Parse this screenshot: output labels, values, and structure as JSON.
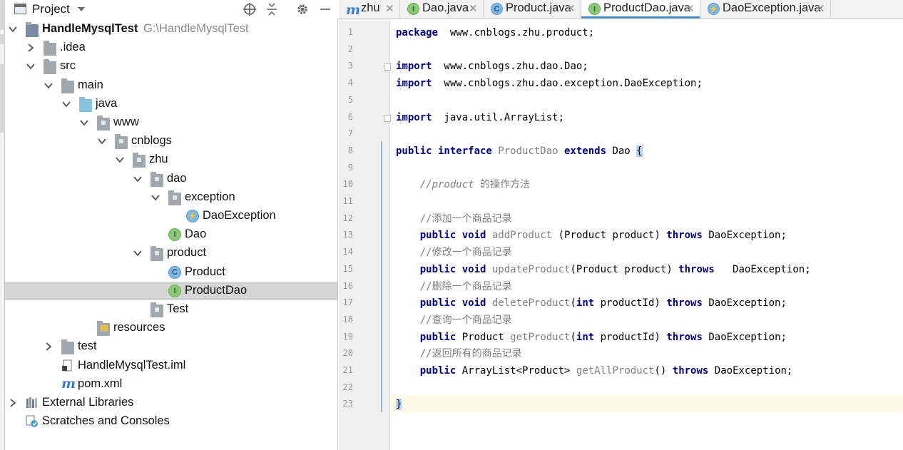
{
  "project_panel": {
    "title": "Project",
    "tree": [
      {
        "label": "HandleMysqlTest",
        "path": "G:\\HandleMysqlTest",
        "bold": true,
        "indent": 0,
        "arrow": "down",
        "icon": "module-folder-icon"
      },
      {
        "label": ".idea",
        "indent": 1,
        "arrow": "right",
        "icon": "folder-icon"
      },
      {
        "label": "src",
        "indent": 1,
        "arrow": "down",
        "icon": "folder-icon"
      },
      {
        "label": "main",
        "indent": 2,
        "arrow": "down",
        "icon": "folder-icon"
      },
      {
        "label": "java",
        "indent": 3,
        "arrow": "down",
        "icon": "source-folder-icon"
      },
      {
        "label": "www",
        "indent": 4,
        "arrow": "down",
        "icon": "package-icon"
      },
      {
        "label": "cnblogs",
        "indent": 5,
        "arrow": "down",
        "icon": "package-icon"
      },
      {
        "label": "zhu",
        "indent": 6,
        "arrow": "down",
        "icon": "package-icon"
      },
      {
        "label": "dao",
        "indent": 7,
        "arrow": "down",
        "icon": "package-icon"
      },
      {
        "label": "exception",
        "indent": 8,
        "arrow": "down",
        "icon": "package-icon"
      },
      {
        "label": "DaoException",
        "indent": 9,
        "arrow": "none",
        "icon": "exception-class-icon"
      },
      {
        "label": "Dao",
        "indent": 8,
        "arrow": "none",
        "icon": "interface-icon"
      },
      {
        "label": "product",
        "indent": 7,
        "arrow": "down",
        "icon": "package-icon"
      },
      {
        "label": "Product",
        "indent": 8,
        "arrow": "none",
        "icon": "class-icon"
      },
      {
        "label": "ProductDao",
        "indent": 8,
        "arrow": "none",
        "icon": "interface-icon",
        "selected": true
      },
      {
        "label": "Test",
        "indent": 7,
        "arrow": "none",
        "icon": "package-icon"
      },
      {
        "label": "resources",
        "indent": 4,
        "arrow": "none",
        "icon": "resources-folder-icon"
      },
      {
        "label": "test",
        "indent": 2,
        "arrow": "right",
        "icon": "folder-icon"
      },
      {
        "label": "HandleMysqlTest.iml",
        "indent": 2,
        "arrow": "none",
        "icon": "iml-file-icon"
      },
      {
        "label": "pom.xml",
        "indent": 2,
        "arrow": "none",
        "icon": "maven-icon"
      },
      {
        "label": "External Libraries",
        "indent": 0,
        "arrow": "right",
        "icon": "libraries-icon"
      },
      {
        "label": "Scratches and Consoles",
        "indent": 0,
        "arrow": "none",
        "icon": "scratches-icon"
      }
    ]
  },
  "tabs": [
    {
      "label": "zhu",
      "icon": "maven-icon",
      "active": false
    },
    {
      "label": "Dao.java",
      "icon": "interface-icon",
      "active": false
    },
    {
      "label": "Product.java",
      "icon": "class-icon",
      "active": false
    },
    {
      "label": "ProductDao.java",
      "icon": "interface-icon",
      "active": true
    },
    {
      "label": "DaoException.java",
      "icon": "exception-class-icon",
      "active": false
    }
  ],
  "editor": {
    "lines": [
      [
        [
          "kw",
          "package"
        ],
        [
          "",
          "  www.cnblogs.zhu.product;"
        ]
      ],
      [],
      [
        [
          "kw",
          "import"
        ],
        [
          "",
          "  www.cnblogs.zhu.dao.Dao;"
        ]
      ],
      [
        [
          "kw",
          "import"
        ],
        [
          "",
          "  www.cnblogs.zhu.dao.exception.DaoException;"
        ]
      ],
      [],
      [
        [
          "kw",
          "import"
        ],
        [
          "",
          "  java.util.ArrayList;"
        ]
      ],
      [],
      [
        [
          "kw",
          "public interface "
        ],
        [
          "ident",
          "ProductDao "
        ],
        [
          "kw",
          "extends "
        ],
        [
          "",
          "Dao "
        ],
        [
          "brace",
          "{"
        ]
      ],
      [],
      [
        [
          "",
          "    "
        ],
        [
          "cm",
          "//product "
        ],
        [
          "cmcn",
          "的操作方法"
        ]
      ],
      [],
      [
        [
          "",
          "    "
        ],
        [
          "cmcn",
          "//添加一个商品记录"
        ]
      ],
      [
        [
          "",
          "    "
        ],
        [
          "kw",
          "public void "
        ],
        [
          "ident",
          "addProduct "
        ],
        [
          "",
          "(Product product) "
        ],
        [
          "kw",
          "throws "
        ],
        [
          "",
          "DaoException;"
        ]
      ],
      [
        [
          "",
          "    "
        ],
        [
          "cmcn",
          "//修改一个商品记录"
        ]
      ],
      [
        [
          "",
          "    "
        ],
        [
          "kw",
          "public void "
        ],
        [
          "ident",
          "updateProduct"
        ],
        [
          "",
          "(Product product) "
        ],
        [
          "kw",
          "throws "
        ],
        [
          "",
          "  DaoException;"
        ]
      ],
      [
        [
          "",
          "    "
        ],
        [
          "cmcn",
          "//删除一个商品记录"
        ]
      ],
      [
        [
          "",
          "    "
        ],
        [
          "kw",
          "public void "
        ],
        [
          "ident",
          "deleteProduct"
        ],
        [
          "",
          "("
        ],
        [
          "kw",
          "int "
        ],
        [
          "",
          "productId) "
        ],
        [
          "kw",
          "throws "
        ],
        [
          "",
          "DaoException;"
        ]
      ],
      [
        [
          "",
          "    "
        ],
        [
          "cmcn",
          "//查询一个商品记录"
        ]
      ],
      [
        [
          "",
          "    "
        ],
        [
          "kw",
          "public "
        ],
        [
          "",
          "Product "
        ],
        [
          "ident",
          "getProduct"
        ],
        [
          "",
          "("
        ],
        [
          "kw",
          "int "
        ],
        [
          "",
          "productId) "
        ],
        [
          "kw",
          "throws "
        ],
        [
          "",
          "DaoException;"
        ]
      ],
      [
        [
          "",
          "    "
        ],
        [
          "cmcn",
          "//返回所有的商品记录"
        ]
      ],
      [
        [
          "",
          "    "
        ],
        [
          "kw",
          "public "
        ],
        [
          "",
          "ArrayList<Product> "
        ],
        [
          "ident",
          "getAllProduct"
        ],
        [
          "",
          "() "
        ],
        [
          "kw",
          "throws "
        ],
        [
          "",
          "DaoException;"
        ]
      ],
      [],
      [
        [
          "brace",
          "}"
        ]
      ]
    ]
  }
}
